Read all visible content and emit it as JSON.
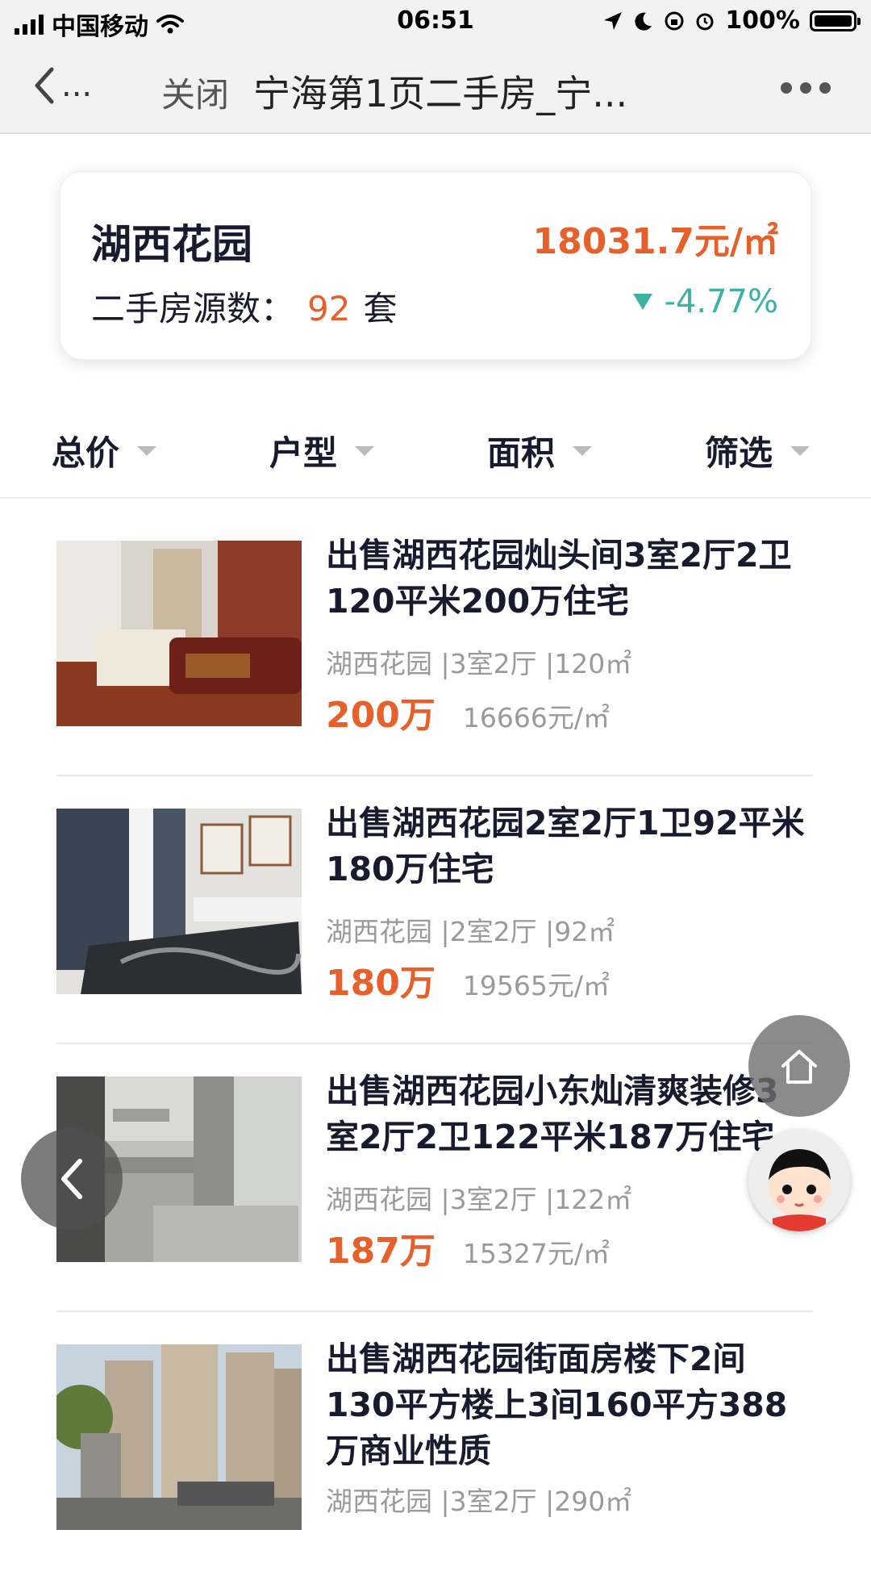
{
  "status_bar": {
    "carrier": "中国移动",
    "time": "06:51",
    "battery": "100%"
  },
  "nav": {
    "back_label": "...",
    "close_label": "关闭",
    "title": "宁海第1页二手房_宁..."
  },
  "summary": {
    "community_name": "湖西花园",
    "listing_count_label": "二手房源数：",
    "listing_count": "92",
    "listing_count_unit": "套",
    "avg_price": "18031.7元/㎡",
    "change": "-4.77%"
  },
  "filters": [
    {
      "label": "总价"
    },
    {
      "label": "户型"
    },
    {
      "label": "面积"
    },
    {
      "label": "筛选"
    }
  ],
  "listings": [
    {
      "title": "出售湖西花园灿头间3室2厅2卫120平米200万住宅",
      "meta": "湖西花园 |3室2厅 |120㎡",
      "total_price": "200万",
      "unit_price": "16666元/㎡"
    },
    {
      "title": "出售湖西花园2室2厅1卫92平米180万住宅",
      "meta": "湖西花园 |2室2厅 |92㎡",
      "total_price": "180万",
      "unit_price": "19565元/㎡"
    },
    {
      "title": "出售湖西花园小东灿清爽装修3室2厅2卫122平米187万住宅",
      "meta": "湖西花园 |3室2厅 |122㎡",
      "total_price": "187万",
      "unit_price": "15327元/㎡"
    },
    {
      "title": "出售湖西花园街面房楼下2间130平方楼上3间160平方388万商业性质",
      "meta": "湖西花园 |3室2厅 |290㎡"
    }
  ],
  "colors": {
    "accent_orange": "#e5602a",
    "down_green": "#3bb3a0"
  }
}
